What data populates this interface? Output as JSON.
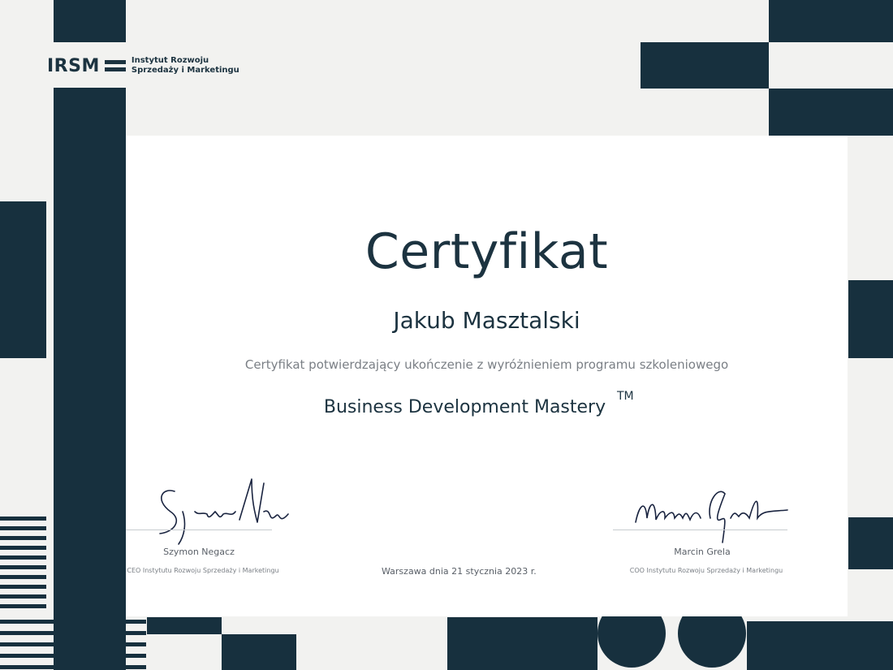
{
  "logo": {
    "mark": "IRSM",
    "line1": "Instytut Rozwoju",
    "line2": "Sprzedaży i Marketingu"
  },
  "certificate": {
    "title": "Certyfikat",
    "recipient": "Jakub Masztalski",
    "description": "Certyfikat potwierdzający ukończenie z wyróżnieniem programu szkoleniowego",
    "program": "Business Development Mastery",
    "trademark": "TM"
  },
  "signatories": [
    {
      "name": "Szymon Negacz",
      "role": "CEO Instytutu Rozwoju Sprzedaży i Marketingu",
      "signature_text": "Szymon Negacz"
    },
    {
      "name": "Marcin Grela",
      "role": "COO Instytutu Rozwoju Sprzedaży i Marketingu",
      "signature_text": "Marcin Grela"
    }
  ],
  "place_date": "Warszawa dnia 21 stycznia 2023 r.",
  "colors": {
    "navy": "#17303e",
    "background": "#f2f2f0",
    "paper": "#ffffff",
    "muted": "#7a7f85"
  }
}
